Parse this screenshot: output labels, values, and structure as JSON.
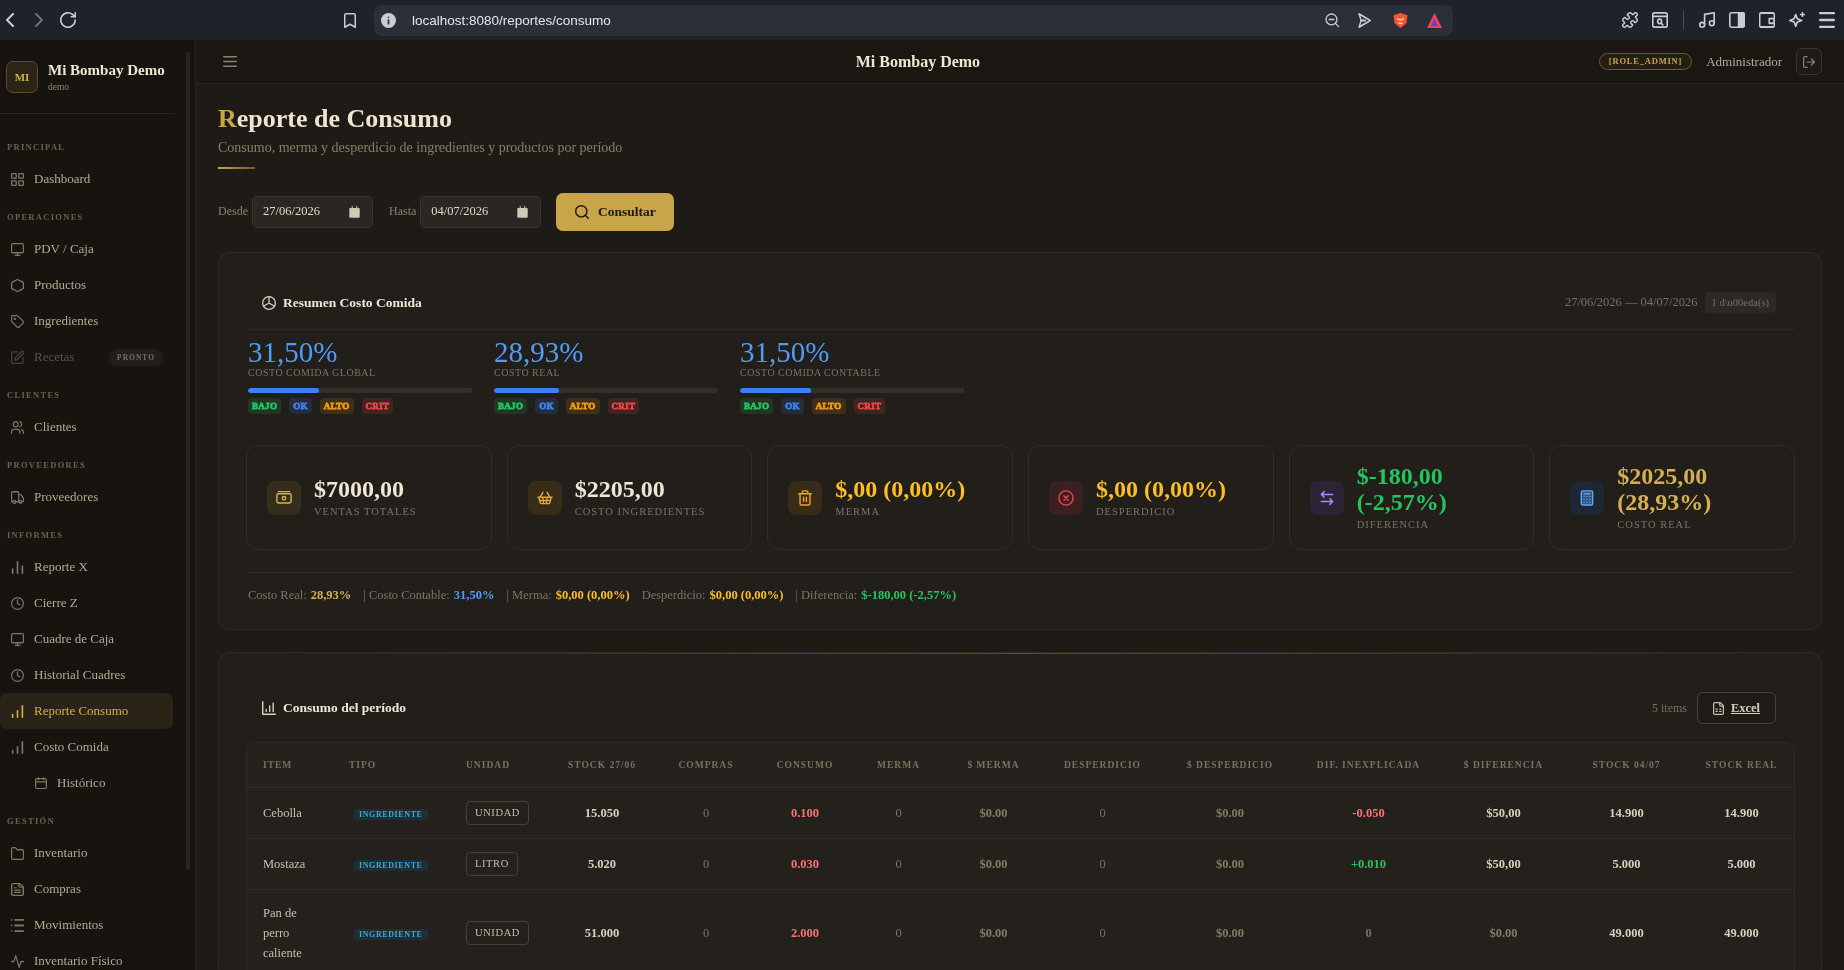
{
  "browser": {
    "url": "localhost:8080/reportes/consumo"
  },
  "sidebar": {
    "logo": "MI",
    "title": "Mi Bombay Demo",
    "subtitle": "demo",
    "sections": [
      {
        "title": "PRINCIPAL",
        "items": [
          {
            "label": "Dashboard",
            "selected": false,
            "disabled": false
          }
        ]
      },
      {
        "title": "OPERACIONES",
        "items": [
          {
            "label": "PDV / Caja",
            "selected": false,
            "disabled": false
          },
          {
            "label": "Productos",
            "selected": false,
            "disabled": false
          },
          {
            "label": "Ingredientes",
            "selected": false,
            "disabled": false
          },
          {
            "label": "Recetas",
            "selected": false,
            "disabled": true,
            "badge": "PRONTO"
          }
        ]
      },
      {
        "title": "CLIENTES",
        "items": [
          {
            "label": "Clientes",
            "selected": false,
            "disabled": false
          }
        ]
      },
      {
        "title": "PROVEEDORES",
        "items": [
          {
            "label": "Proveedores",
            "selected": false,
            "disabled": false
          }
        ]
      },
      {
        "title": "INFORMES",
        "items": [
          {
            "label": "Reporte X",
            "selected": false,
            "disabled": false
          },
          {
            "label": "Cierre Z",
            "selected": false,
            "disabled": false
          },
          {
            "label": "Cuadre de Caja",
            "selected": false,
            "disabled": false
          },
          {
            "label": "Historial Cuadres",
            "selected": false,
            "disabled": false
          },
          {
            "label": "Reporte Consumo",
            "selected": true,
            "disabled": false
          },
          {
            "label": "Costo Comida",
            "selected": false,
            "disabled": false,
            "children": [
              {
                "label": "Histórico",
                "selected": false,
                "disabled": false
              }
            ]
          }
        ]
      },
      {
        "title": "GESTIÓN",
        "items": [
          {
            "label": "Inventario",
            "selected": false,
            "disabled": false
          },
          {
            "label": "Compras",
            "selected": false,
            "disabled": false
          },
          {
            "label": "Movimientos",
            "selected": false,
            "disabled": false
          },
          {
            "label": "Inventario Físico",
            "selected": false,
            "disabled": false
          }
        ]
      }
    ]
  },
  "header": {
    "title": "Mi Bombay Demo",
    "role": "[ROLE_ADMIN]",
    "user": "Administrador"
  },
  "page": {
    "title": "Reporte de Consumo",
    "subtitle": "Consumo, merma y desperdicio de ingredientes y productos por período"
  },
  "filters": {
    "from_label": "Desde",
    "from_value": "27/06/2026",
    "to_label": "Hasta",
    "to_value": "04/07/2026",
    "button": "Consultar"
  },
  "summary": {
    "title": "Resumen Costo Comida",
    "range": "27/06/2026 — 04/07/2026",
    "days": "1 d\\u00eda(s)",
    "gauges": [
      {
        "value": "31,50%",
        "label": "COSTO COMIDA GLOBAL",
        "level": 0.315,
        "badges": [
          {
            "label": "BAJO",
            "color": "#22c55e"
          },
          {
            "label": "OK",
            "color": "#3b82f6"
          },
          {
            "label": "ALTO",
            "color": "#f59e0b"
          },
          {
            "label": "CRIT",
            "color": "#ef4444"
          }
        ]
      },
      {
        "value": "28,93%",
        "label": "COSTO REAL",
        "level": 0.2893,
        "badges": [
          {
            "label": "BAJO",
            "color": "#22c55e"
          },
          {
            "label": "OK",
            "color": "#3b82f6"
          },
          {
            "label": "ALTO",
            "color": "#f59e0b"
          },
          {
            "label": "CRIT",
            "color": "#ef4444"
          }
        ]
      },
      {
        "value": "31,50%",
        "label": "COSTO COMIDA CONTABLE",
        "level": 0.315,
        "badges": [
          {
            "label": "BAJO",
            "color": "#22c55e"
          },
          {
            "label": "OK",
            "color": "#3b82f6"
          },
          {
            "label": "ALTO",
            "color": "#f59e0b"
          },
          {
            "label": "CRIT",
            "color": "#ef4444"
          }
        ]
      }
    ],
    "stats": [
      {
        "value": "$7000,00",
        "label": "VENTAS TOTALES",
        "color": "#efe6d4"
      },
      {
        "value": "$2205,00",
        "label": "COSTO INGREDIENTES",
        "color": "#efe6d4"
      },
      {
        "value": "$,00 (0,00%)",
        "label": "MERMA",
        "color": "#fbbf24"
      },
      {
        "value": "$,00 (0,00%)",
        "label": "DESPERDICIO",
        "color": "#fbbf24"
      },
      {
        "value": "$-180,00 (-2,57%)",
        "label": "DIFERENCIA",
        "color": "#22c55e"
      },
      {
        "value": "$2025,00 (28,93%)",
        "label": "COSTO REAL",
        "color": "#d4b050"
      }
    ],
    "breakdown": [
      {
        "label": "Costo Real:",
        "value": "28,93%",
        "color": "#d4b050"
      },
      {
        "label": "| Costo Contable:",
        "value": "31,50%",
        "color": "#4f9cf8"
      },
      {
        "label": "| Merma:",
        "value": "$0,00 (0,00%)",
        "color": "#fbbf24"
      },
      {
        "label": "Desperdicio:",
        "value": "$0,00 (0,00%)",
        "color": "#fbbf24"
      },
      {
        "label": "| Diferencia:",
        "value": "$-180,00 (-2,57%)",
        "color": "#22c55e"
      }
    ]
  },
  "consumption": {
    "title": "Consumo del período",
    "count": "5 items",
    "export_button": "Excel",
    "table": {
      "columns": [
        "ITEM",
        "TIPO",
        "UNIDAD",
        "STOCK 27/06",
        "COMPRAS",
        "CONSUMO",
        "MERMA",
        "$ MERMA",
        "DESPERDICIO",
        "$ DESPERDICIO",
        "DIF. INEXPLICADA",
        "$ DIFERENCIA",
        "STOCK 04/07",
        "STOCK REAL"
      ],
      "rows": [
        {
          "item": "Cebolla",
          "tipo": "INGREDIENTE",
          "unidad": "UNIDAD",
          "stock_inicial": "15.050",
          "compras": "0",
          "consumo": "0.100",
          "merma": "0",
          "monto_merma": "$0.00",
          "desperdicio": "0",
          "monto_desperdicio": "$0.00",
          "dif_inexplicada": {
            "text": "-0.050",
            "color": "#f87171"
          },
          "monto_diferencia": {
            "text": "$50,00",
            "color": "#d8cfbd"
          },
          "stock_final": "14.900",
          "stock_real": "14.900"
        },
        {
          "item": "Mostaza",
          "tipo": "INGREDIENTE",
          "unidad": "LITRO",
          "stock_inicial": "5.020",
          "compras": "0",
          "consumo": "0.030",
          "merma": "0",
          "monto_merma": "$0.00",
          "desperdicio": "0",
          "monto_desperdicio": "$0.00",
          "dif_inexplicada": {
            "text": "+0.010",
            "color": "#22c55e"
          },
          "monto_diferencia": {
            "text": "$50,00",
            "color": "#d8cfbd"
          },
          "stock_final": "5.000",
          "stock_real": "5.000"
        },
        {
          "item": "Pan de perro caliente",
          "tipo": "INGREDIENTE",
          "unidad": "UNIDAD",
          "stock_inicial": "51.000",
          "compras": "0",
          "consumo": "2.000",
          "merma": "0",
          "monto_merma": "$0.00",
          "desperdicio": "0",
          "monto_desperdicio": "$0.00",
          "dif_inexplicada": {
            "text": "0",
            "color": "#7a7060"
          },
          "monto_diferencia": {
            "text": "$0.00",
            "color": "#857a66"
          },
          "stock_final": "49.000",
          "stock_real": "49.000"
        }
      ]
    }
  }
}
